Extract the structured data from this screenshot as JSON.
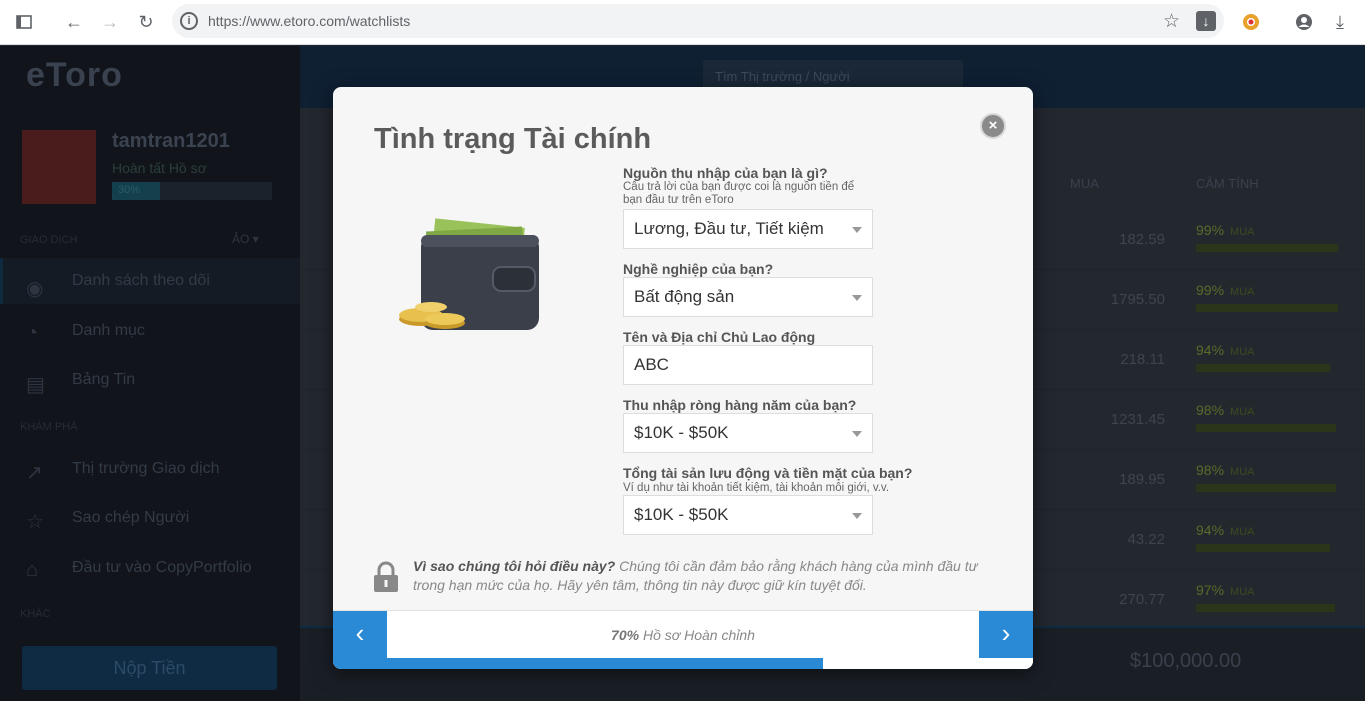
{
  "browser": {
    "url": "https://www.etoro.com/watchlists"
  },
  "app": {
    "logo": "eToro",
    "search_placeholder": "Tìm Thị trường / Người",
    "username": "tamtran1201",
    "profile_status": "Hoàn tất Hồ sơ",
    "profile_percent": "30%",
    "sections": [
      "GIAO DỊCH",
      "KHÁM PHÁ",
      "KHÁC"
    ],
    "mode_toggle": "ẢO ▾",
    "menu": [
      "Danh sách theo dõi",
      "Danh mục",
      "Bảng Tin",
      "Thị trường Giao dịch",
      "Sao chép Người",
      "Đầu tư vào CopyPortfolio"
    ],
    "deposit": "Nộp Tiền",
    "columns": {
      "buy": "MUA",
      "sentiment": "CẢM TÍNH"
    },
    "rows": [
      {
        "price": "182.59",
        "pct": "99%",
        "sent": "MUA",
        "fill": 0.99
      },
      {
        "price": "1795.50",
        "pct": "99%",
        "sent": "MUA",
        "fill": 0.99
      },
      {
        "price": "218.11",
        "pct": "94%",
        "sent": "MUA",
        "fill": 0.94
      },
      {
        "price": "1231.45",
        "pct": "98%",
        "sent": "MUA",
        "fill": 0.98
      },
      {
        "price": "189.95",
        "pct": "98%",
        "sent": "MUA",
        "fill": 0.98
      },
      {
        "price": "43.22",
        "pct": "94%",
        "sent": "MUA",
        "fill": 0.94
      },
      {
        "price": "270.77",
        "pct": "97%",
        "sent": "MUA",
        "fill": 0.97
      }
    ],
    "balance": "$100,000.00"
  },
  "modal": {
    "title": "Tình trạng Tài chính",
    "q1": {
      "label": "Nguồn thu nhập của bạn là gì?",
      "hint": "Câu trả lời của bạn được coi là nguồn tiền để bạn đầu tư trên eToro",
      "value": "Lương, Đầu tư, Tiết kiệm"
    },
    "q2": {
      "label": "Nghề nghiệp của bạn?",
      "value": "Bất động sản"
    },
    "q3": {
      "label": "Tên và Địa chỉ Chủ Lao động",
      "value": "ABC"
    },
    "q4": {
      "label": "Thu nhập ròng hàng năm của bạn?",
      "value": "$10K - $50K"
    },
    "q5": {
      "label": "Tổng tài sản lưu động và tiền mặt của bạn?",
      "hint": "Ví dụ như tài khoản tiết kiệm, tài khoản môi giới, v.v.",
      "value": "$10K - $50K"
    },
    "why_title": "Vì sao chúng tôi hỏi điều này?",
    "why_text": " Chúng tôi cần đảm bảo rằng khách hàng của mình đầu tư trong hạn mức của họ. Hãy yên tâm, thông tin này được giữ kín tuyệt đối.",
    "progress_pct": "70%",
    "progress_label": " Hồ sơ Hoàn chỉnh",
    "progress_fraction": 0.7
  }
}
